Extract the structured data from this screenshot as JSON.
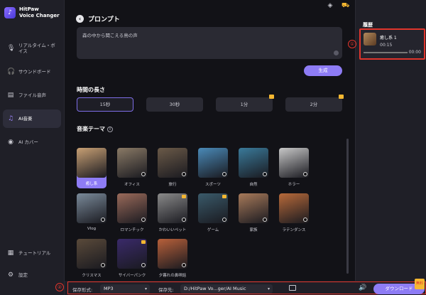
{
  "app": {
    "brand_line1": "HitPaw",
    "brand_line2": "Voice Changer"
  },
  "sidebar": {
    "items": [
      {
        "label": "リアルタイム・ボイス",
        "icon": "mic-icon"
      },
      {
        "label": "サウンドボード",
        "icon": "headphones-icon"
      },
      {
        "label": "ファイル音声",
        "icon": "file-icon"
      },
      {
        "label": "AI音楽",
        "icon": "ai-music-icon"
      },
      {
        "label": "AI カバー",
        "icon": "ai-cover-icon"
      }
    ],
    "bottom": [
      {
        "label": "チュートリアル",
        "icon": "tutorial-icon"
      },
      {
        "label": "設定",
        "icon": "gear-icon"
      }
    ]
  },
  "header": {
    "title": "プロンプト"
  },
  "prompt": {
    "value": "森の中から聞こえる鳥の声"
  },
  "generate_label": "生成",
  "duration": {
    "title": "時間の長さ",
    "options": [
      {
        "label": "15秒",
        "active": true,
        "premium": false
      },
      {
        "label": "30秒",
        "active": false,
        "premium": false
      },
      {
        "label": "1分",
        "active": false,
        "premium": true
      },
      {
        "label": "2分",
        "active": false,
        "premium": true
      }
    ]
  },
  "theme": {
    "title": "音楽テーマ",
    "tiles": [
      {
        "label": "癒し系",
        "active": true,
        "premium": false,
        "color": "#c8a074"
      },
      {
        "label": "オフィス",
        "active": false,
        "premium": false,
        "color": "#8a7a66"
      },
      {
        "label": "旅行",
        "active": false,
        "premium": false,
        "color": "#6b5a48"
      },
      {
        "label": "スポーツ",
        "active": false,
        "premium": false,
        "color": "#4a8ab8"
      },
      {
        "label": "自然",
        "active": false,
        "premium": false,
        "color": "#3a7a9a"
      },
      {
        "label": "ホラー",
        "active": false,
        "premium": false,
        "color": "#c8c8c8"
      },
      {
        "label": "Vlog",
        "active": false,
        "premium": false,
        "color": "#7a8a9a"
      },
      {
        "label": "ロマンチック",
        "active": false,
        "premium": false,
        "color": "#9a6a5a"
      },
      {
        "label": "かわいいペット",
        "active": false,
        "premium": true,
        "color": "#8a8a8a"
      },
      {
        "label": "ゲーム",
        "active": false,
        "premium": true,
        "color": "#3a5a6a"
      },
      {
        "label": "家族",
        "active": false,
        "premium": false,
        "color": "#a87a5a"
      },
      {
        "label": "ラテンダンス",
        "active": false,
        "premium": false,
        "color": "#b86a3a"
      },
      {
        "label": "クリスマス",
        "active": false,
        "premium": false,
        "color": "#5a4a3a"
      },
      {
        "label": "サイバーパンク",
        "active": false,
        "premium": true,
        "color": "#3a2a6a"
      },
      {
        "label": "夕暮れの鼻唄話",
        "active": false,
        "premium": false,
        "color": "#b8603a"
      }
    ]
  },
  "history": {
    "title": "履歴",
    "item": {
      "title": "癒し系 1",
      "time": "00:15",
      "end_time": "00:00"
    },
    "marker": "①"
  },
  "bottom": {
    "marker": "②",
    "format_label": "保存形式:",
    "format_value": "MP3",
    "dest_label": "保存先:",
    "dest_value": "D:/HitPaw Vo...ger/AI Music",
    "download_label": "ダウンロード",
    "download_tag": "無料"
  },
  "colors": {
    "accent": "#8e7cf5",
    "premium": "#f5b731",
    "highlight": "#e0352c"
  }
}
